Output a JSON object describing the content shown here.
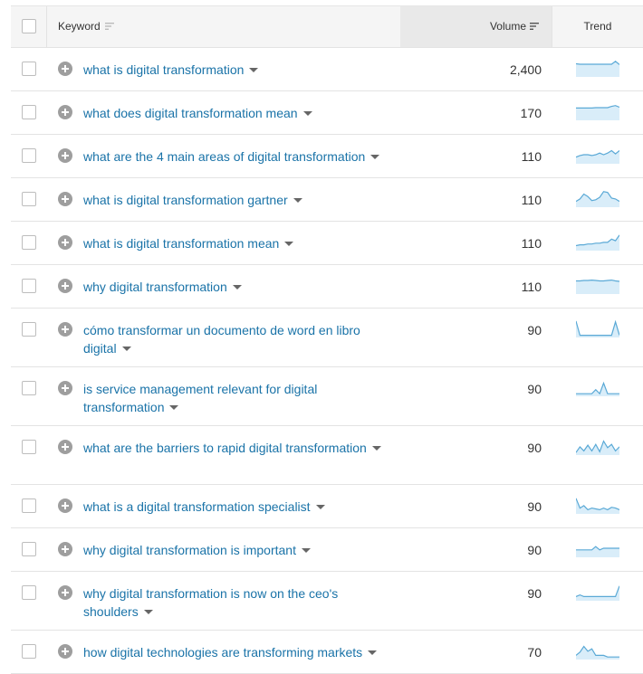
{
  "header": {
    "keyword_label": "Keyword",
    "volume_label": "Volume",
    "trend_label": "Trend"
  },
  "rows": [
    {
      "keyword": "what is digital transformation",
      "volume": "2,400",
      "trend": [
        0.75,
        0.72,
        0.72,
        0.72,
        0.72,
        0.72,
        0.72,
        0.72,
        0.72,
        0.72,
        0.9,
        0.7
      ]
    },
    {
      "keyword": "what does digital transformation mean",
      "volume": "170",
      "trend": [
        0.7,
        0.7,
        0.7,
        0.7,
        0.7,
        0.72,
        0.72,
        0.72,
        0.72,
        0.8,
        0.85,
        0.75
      ]
    },
    {
      "keyword": "what are the 4 main areas of digital transformation",
      "volume": "110",
      "trend": [
        0.35,
        0.45,
        0.5,
        0.5,
        0.45,
        0.5,
        0.6,
        0.5,
        0.6,
        0.75,
        0.55,
        0.75
      ]
    },
    {
      "keyword": "what is digital transformation gartner",
      "volume": "110",
      "trend": [
        0.3,
        0.45,
        0.75,
        0.6,
        0.35,
        0.4,
        0.55,
        0.9,
        0.85,
        0.5,
        0.45,
        0.3
      ]
    },
    {
      "keyword": "what is digital transformation mean",
      "volume": "110",
      "trend": [
        0.25,
        0.3,
        0.3,
        0.35,
        0.35,
        0.4,
        0.4,
        0.45,
        0.45,
        0.65,
        0.55,
        0.9
      ]
    },
    {
      "keyword": "why digital transformation",
      "volume": "110",
      "trend": [
        0.75,
        0.75,
        0.78,
        0.78,
        0.8,
        0.78,
        0.75,
        0.75,
        0.78,
        0.8,
        0.75,
        0.72
      ]
    },
    {
      "keyword": "cómo transformar un documento de word en libro digital",
      "volume": "90",
      "trend": [
        0.95,
        0.08,
        0.08,
        0.08,
        0.08,
        0.08,
        0.08,
        0.08,
        0.08,
        0.08,
        0.9,
        0.08
      ]
    },
    {
      "keyword": "is service management relevant for digital transformation",
      "volume": "90",
      "trend": [
        0.1,
        0.1,
        0.1,
        0.1,
        0.1,
        0.35,
        0.1,
        0.75,
        0.1,
        0.1,
        0.1,
        0.1
      ]
    },
    {
      "keyword": "what are the barriers to rapid digital transformation",
      "volume": "90",
      "trend": [
        0.1,
        0.45,
        0.2,
        0.55,
        0.2,
        0.6,
        0.15,
        0.8,
        0.4,
        0.6,
        0.2,
        0.45
      ]
    },
    {
      "keyword": "what is a digital transformation specialist",
      "volume": "90",
      "trend": [
        0.9,
        0.3,
        0.45,
        0.2,
        0.3,
        0.25,
        0.2,
        0.3,
        0.2,
        0.35,
        0.3,
        0.2
      ]
    },
    {
      "keyword": "why digital transformation is important",
      "volume": "90",
      "trend": [
        0.4,
        0.4,
        0.4,
        0.4,
        0.4,
        0.6,
        0.4,
        0.5,
        0.5,
        0.5,
        0.5,
        0.5
      ]
    },
    {
      "keyword": "why digital transformation is now on the ceo's shoulders",
      "volume": "90",
      "trend": [
        0.2,
        0.3,
        0.2,
        0.2,
        0.2,
        0.2,
        0.2,
        0.2,
        0.2,
        0.2,
        0.2,
        0.85
      ]
    },
    {
      "keyword": "how digital technologies are transforming markets",
      "volume": "70",
      "trend": [
        0.2,
        0.4,
        0.75,
        0.45,
        0.6,
        0.2,
        0.2,
        0.2,
        0.1,
        0.1,
        0.1,
        0.1
      ]
    }
  ],
  "colors": {
    "link": "#1a73a8",
    "spark_line": "#5aa9d6",
    "spark_fill": "#d9edf9"
  }
}
